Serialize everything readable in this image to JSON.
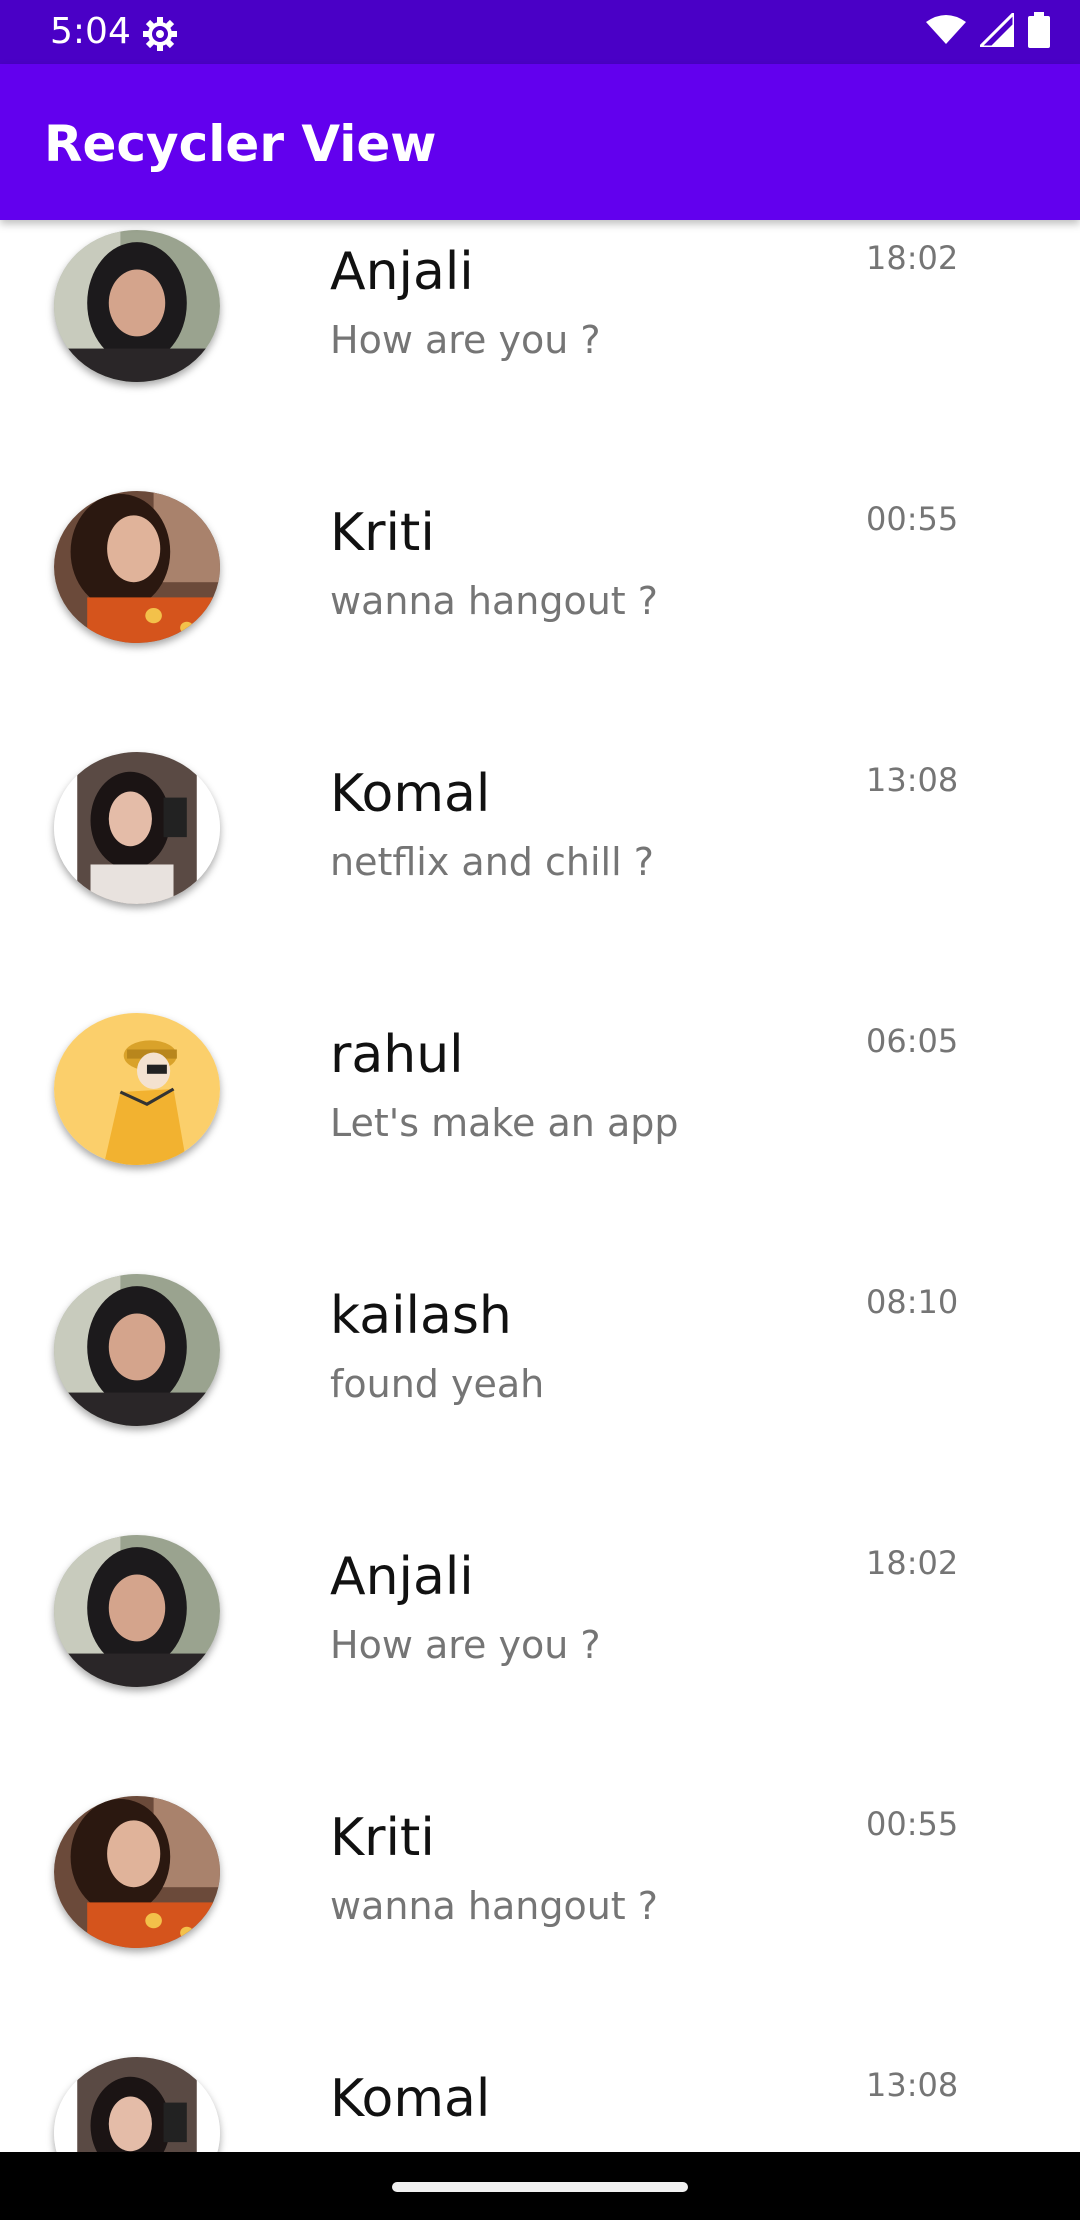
{
  "status_bar": {
    "time": "5:04",
    "icons": [
      "settings-gear-icon",
      "wifi-icon",
      "signal-icon",
      "battery-icon"
    ]
  },
  "app_bar": {
    "title": "Recycler View",
    "color": "#6200ee"
  },
  "chats": [
    {
      "name": "Anjali",
      "message": "How are you ?",
      "time": "18:02",
      "avatar": "photo-woman-dark-hair"
    },
    {
      "name": "Kriti",
      "message": "wanna hangout ?",
      "time": "00:55",
      "avatar": "photo-woman-red-dress"
    },
    {
      "name": "Komal",
      "message": "netflix and chill ?",
      "time": "13:08",
      "avatar": "photo-woman-selfie"
    },
    {
      "name": "rahul",
      "message": "Let's make an app",
      "time": "06:05",
      "avatar": "illustration-man-yellow"
    },
    {
      "name": "kailash",
      "message": "found yeah",
      "time": "08:10",
      "avatar": "photo-woman-dark-hair"
    },
    {
      "name": "Anjali",
      "message": "How are you ?",
      "time": "18:02",
      "avatar": "photo-woman-dark-hair"
    },
    {
      "name": "Kriti",
      "message": "wanna hangout ?",
      "time": "00:55",
      "avatar": "photo-woman-red-dress"
    },
    {
      "name": "Komal",
      "message": "",
      "time": "13:08",
      "avatar": "photo-woman-selfie"
    }
  ]
}
